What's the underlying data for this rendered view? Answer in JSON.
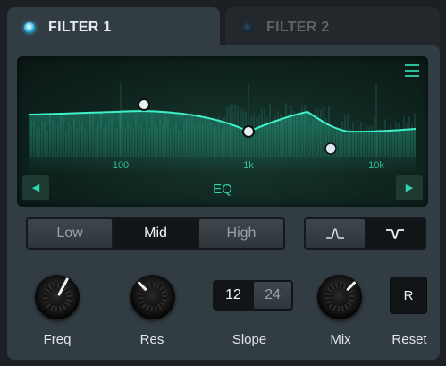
{
  "tabs": [
    {
      "label": "FILTER 1",
      "active": true,
      "led": "on"
    },
    {
      "label": "FILTER 2",
      "active": false,
      "led": "off"
    }
  ],
  "eq": {
    "mode_label": "EQ",
    "menu_icon": "hamburger-menu-icon",
    "prev_icon": "triangle-left-icon",
    "next_icon": "triangle-right-icon",
    "freq_labels": [
      "100",
      "1k",
      "10k"
    ],
    "accent_color": "#2fd6b0"
  },
  "band_selector": {
    "options": [
      "Low",
      "Mid",
      "High"
    ],
    "selected": "Mid"
  },
  "shape_selector": {
    "options": [
      "peak-shape-icon",
      "notch-shape-icon"
    ],
    "selected": "notch-shape-icon"
  },
  "controls": {
    "freq_label": "Freq",
    "res_label": "Res",
    "slope_label": "Slope",
    "slope_options": [
      "12",
      "24"
    ],
    "slope_selected": "12",
    "mix_label": "Mix",
    "reset_label": "Reset",
    "reset_button_text": "R"
  }
}
